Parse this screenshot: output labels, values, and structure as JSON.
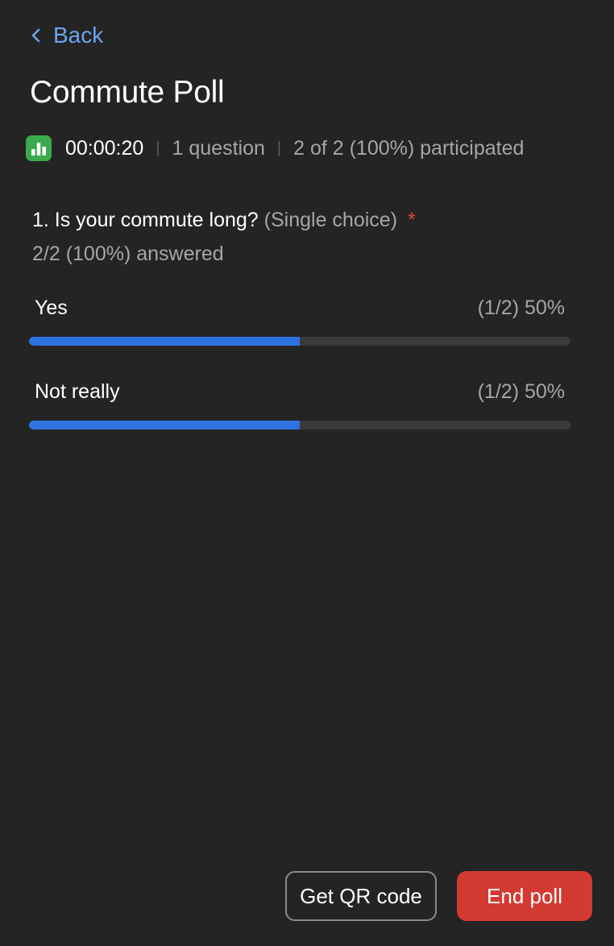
{
  "nav": {
    "back_label": "Back"
  },
  "poll": {
    "title": "Commute Poll",
    "icon": "poll-chart-icon",
    "timer": "00:00:20",
    "question_count": "1 question",
    "participation": "2 of 2 (100%) participated"
  },
  "question": {
    "text": "1. Is your commute long?",
    "type": "(Single choice)",
    "required_marker": "*",
    "answered": "2/2 (100%) answered",
    "options": [
      {
        "label": "Yes",
        "stat": "(1/2) 50%",
        "fraction": 0.5
      },
      {
        "label": "Not really",
        "stat": "(1/2) 50%",
        "fraction": 0.5
      }
    ]
  },
  "actions": {
    "qr_label": "Get QR code",
    "end_label": "End poll"
  },
  "colors": {
    "background": "#242424",
    "accent_link": "#6aa5f0",
    "bar_fill": "#2f73e0",
    "bar_track": "#3a3a3a",
    "end_button": "#d33a32",
    "poll_icon": "#3aaa4d",
    "required": "#e0453c"
  }
}
